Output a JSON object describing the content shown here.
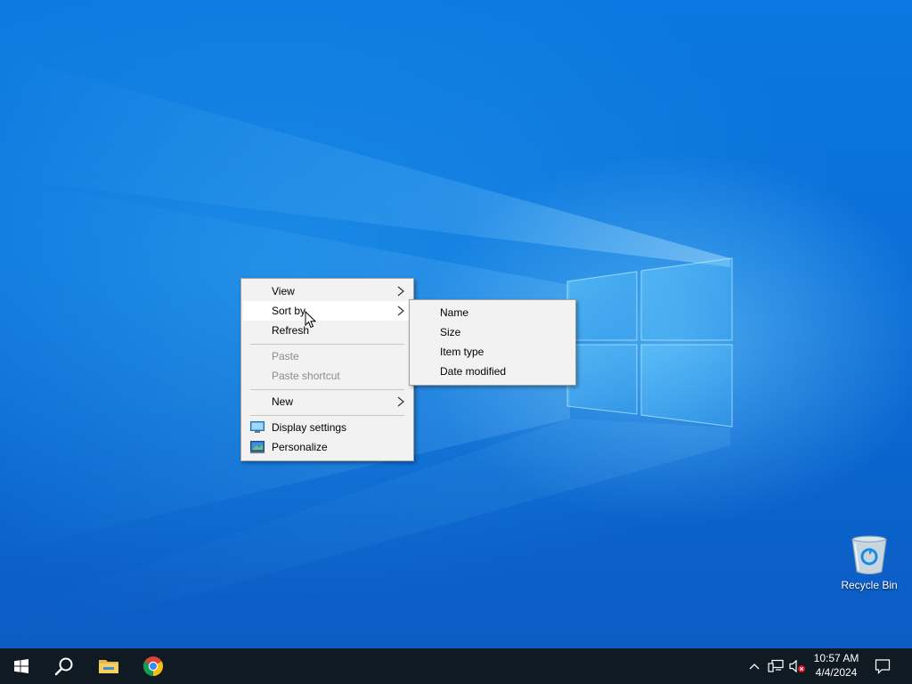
{
  "desktop": {
    "icons": [
      {
        "name": "Recycle Bin",
        "icon": "recycle-bin-icon"
      }
    ]
  },
  "context_menu": {
    "items": [
      {
        "label": "View",
        "submenu": true
      },
      {
        "label": "Sort by",
        "submenu": true,
        "highlighted": true
      },
      {
        "label": "Refresh"
      },
      {
        "label": "Paste",
        "disabled": true
      },
      {
        "label": "Paste shortcut",
        "disabled": true
      },
      {
        "label": "New",
        "submenu": true
      },
      {
        "label": "Display settings",
        "icon": "display-settings-icon"
      },
      {
        "label": "Personalize",
        "icon": "personalize-icon"
      }
    ],
    "sort_by_submenu": [
      {
        "label": "Name"
      },
      {
        "label": "Size"
      },
      {
        "label": "Item type"
      },
      {
        "label": "Date modified"
      }
    ]
  },
  "taskbar": {
    "buttons": [
      {
        "name": "Start",
        "icon": "windows-start-icon"
      },
      {
        "name": "Search",
        "icon": "search-icon"
      },
      {
        "name": "File Explorer",
        "icon": "folder-icon"
      },
      {
        "name": "Google Chrome",
        "icon": "chrome-icon"
      }
    ],
    "tray": {
      "icons": [
        "chevron-up-icon",
        "network-icon",
        "volume-muted-icon",
        "notification-icon"
      ],
      "time": "10:57 AM",
      "date": "4/4/2024"
    }
  },
  "colors": {
    "taskbar": "#101a22",
    "menu_background": "#f2f2f2",
    "menu_highlight": "#ffffff",
    "disabled_text": "#8c8c8c",
    "wallpaper": "#0b6fd8"
  }
}
